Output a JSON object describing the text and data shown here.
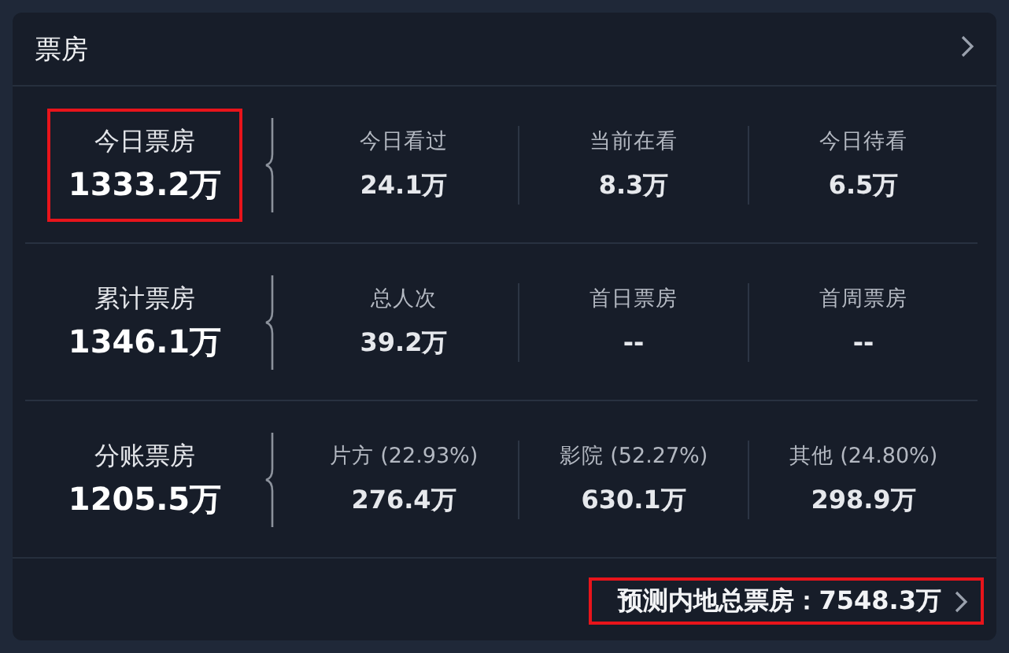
{
  "card": {
    "title": "票房"
  },
  "rows": [
    {
      "main": {
        "label": "今日票房",
        "value": "1333.2万",
        "highlighted": true
      },
      "stats": [
        {
          "label": "今日看过",
          "value": "24.1万"
        },
        {
          "label": "当前在看",
          "value": "8.3万"
        },
        {
          "label": "今日待看",
          "value": "6.5万"
        }
      ]
    },
    {
      "main": {
        "label": "累计票房",
        "value": "1346.1万",
        "highlighted": false
      },
      "stats": [
        {
          "label": "总人次",
          "value": "39.2万"
        },
        {
          "label": "首日票房",
          "value": "--"
        },
        {
          "label": "首周票房",
          "value": "--"
        }
      ]
    },
    {
      "main": {
        "label": "分账票房",
        "value": "1205.5万",
        "highlighted": false
      },
      "stats": [
        {
          "label": "片方 (22.93%)",
          "value": "276.4万"
        },
        {
          "label": "影院 (52.27%)",
          "value": "630.1万"
        },
        {
          "label": "其他 (24.80%)",
          "value": "298.9万"
        }
      ]
    }
  ],
  "forecast": {
    "text": "预测内地总票房：7548.3万",
    "highlighted": true
  }
}
